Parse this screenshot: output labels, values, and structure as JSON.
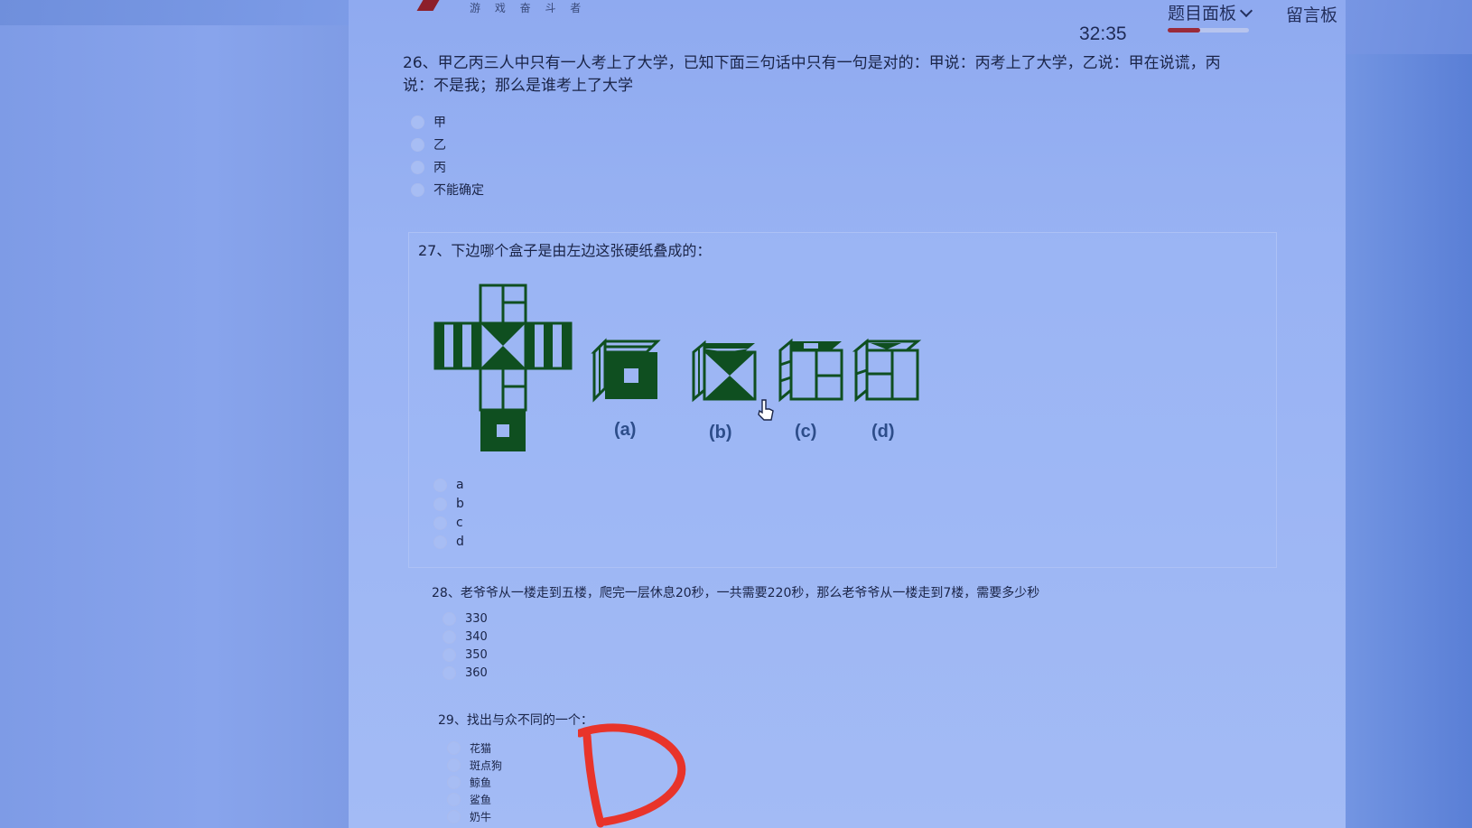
{
  "header": {
    "logo_text": "游 戏 奋 斗 者",
    "timer": "32:35",
    "panel_label": "题目面板",
    "message_board": "留言板",
    "progress_fraction": 0.4
  },
  "questions": [
    {
      "number_title": "26、甲乙丙三人中只有一人考上了大学，已知下面三句话中只有一句是对的：甲说：丙考上了大学，乙说：甲在说谎，丙说：不是我；那么是谁考上了大学",
      "options": [
        "甲",
        "乙",
        "丙",
        "不能确定"
      ]
    },
    {
      "number_title": "27、下边哪个盒子是由左边这张硬纸叠成的：",
      "figure_labels": [
        "(a)",
        "(b)",
        "(c)",
        "(d)"
      ],
      "options": [
        "a",
        "b",
        "c",
        "d"
      ]
    },
    {
      "number_title": "28、老爷爷从一楼走到五楼，爬完一层休息20秒，一共需要220秒，那么老爷爷从一楼走到7楼，需要多少秒",
      "options": [
        "330",
        "340",
        "350",
        "360"
      ]
    },
    {
      "number_title": "29、找出与众不同的一个：",
      "options": [
        "花猫",
        "斑点狗",
        "鲸鱼",
        "鲨鱼",
        "奶牛"
      ]
    }
  ],
  "annotation": {
    "handwritten": "D",
    "color": "#e8342a"
  },
  "colors": {
    "cube_green": "#0f4f20",
    "text": "#1a2447",
    "accent_red": "#9a2a3a"
  }
}
